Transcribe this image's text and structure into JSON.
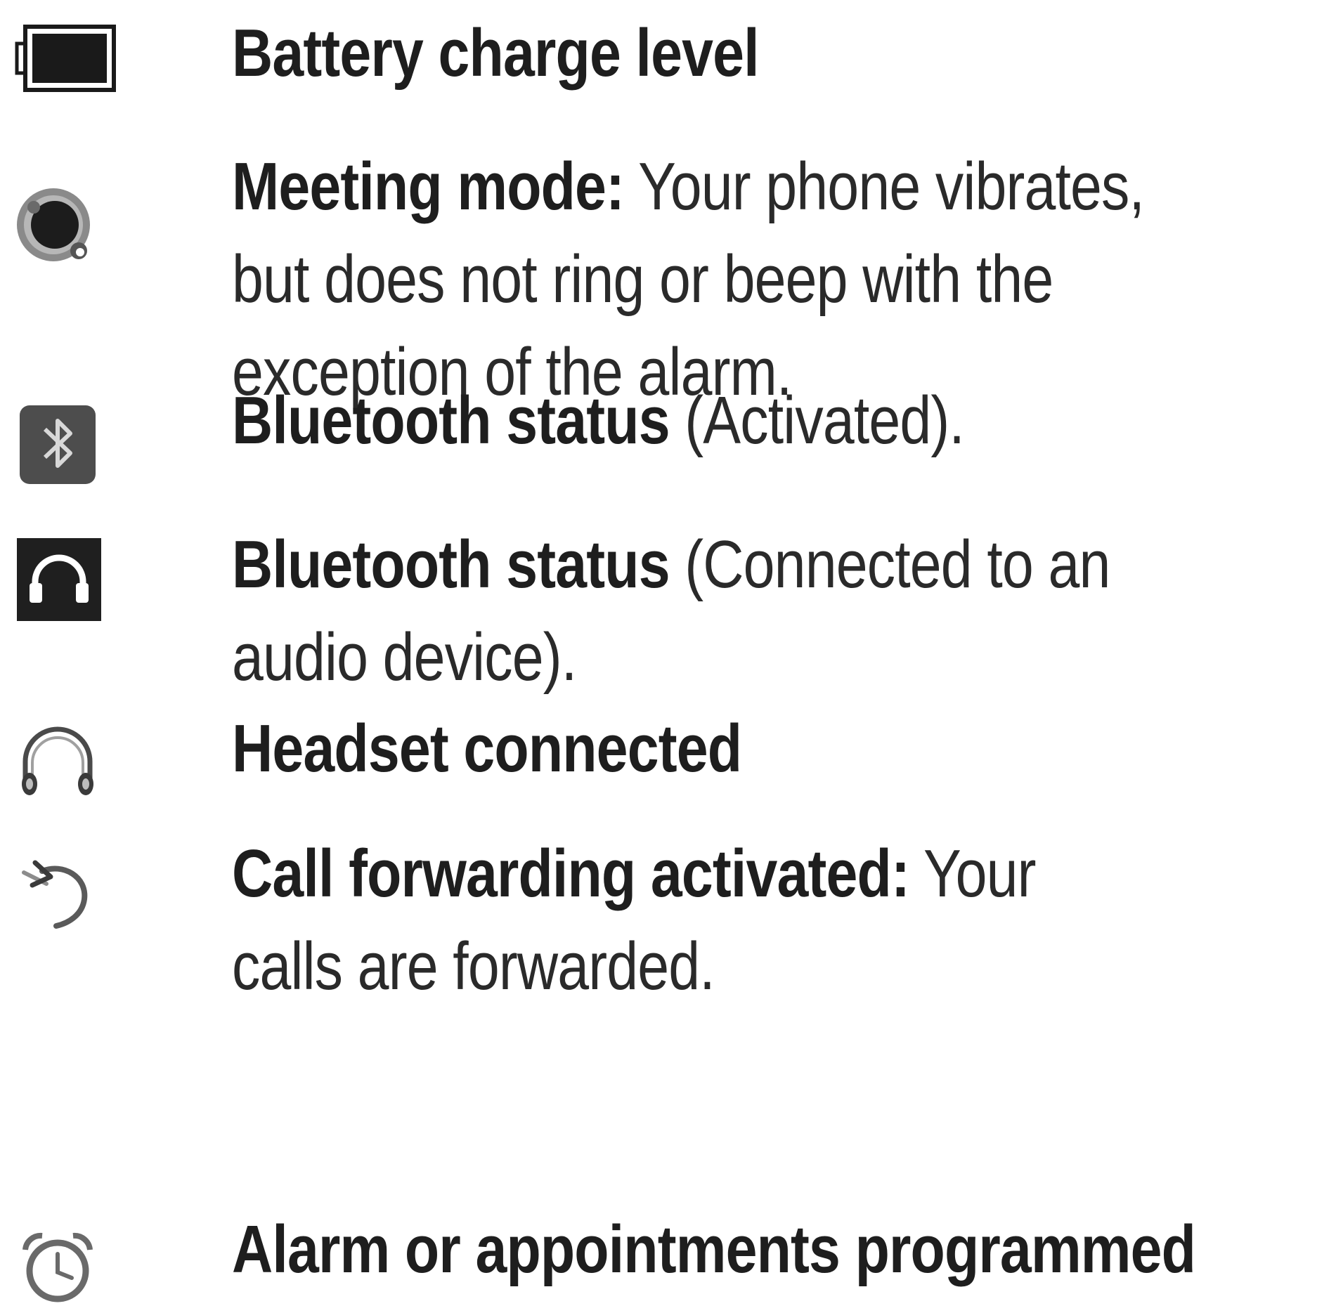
{
  "items": [
    {
      "icon": "battery-icon",
      "bold": "Battery charge level",
      "text": ""
    },
    {
      "icon": "meeting-mode-icon",
      "bold": "Meeting mode:",
      "text": " Your phone vibrates, but does not ring or beep with the exception of the alarm."
    },
    {
      "icon": "bluetooth-icon",
      "bold": "Bluetooth status",
      "text": " (Activated)."
    },
    {
      "icon": "bluetooth-audio-icon",
      "bold": "Bluetooth status",
      "text": " (Connected to an audio device)."
    },
    {
      "icon": "headset-icon",
      "bold": "Headset connected",
      "text": ""
    },
    {
      "icon": "call-forwarding-icon",
      "bold": "Call forwarding activated:",
      "text": " Your calls are forwarded."
    },
    {
      "icon": "alarm-clock-icon",
      "bold": "Alarm or appointments programmed",
      "text": ""
    }
  ]
}
